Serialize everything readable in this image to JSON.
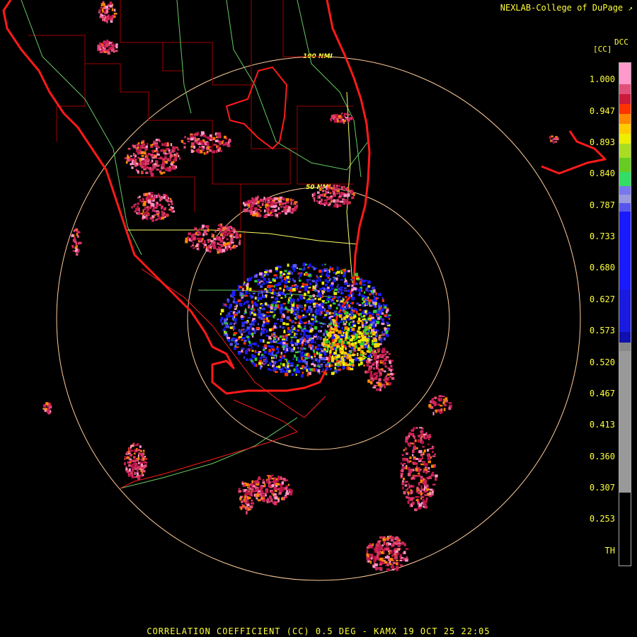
{
  "header": {
    "credit": "NEXLAB-College of DuPage",
    "credit_icon": "external-link-icon"
  },
  "legend": {
    "product": "DCC",
    "unit": "[CC]",
    "ticks": [
      "1.000",
      "0.947",
      "0.893",
      "0.840",
      "0.787",
      "0.733",
      "0.680",
      "0.627",
      "0.573",
      "0.520",
      "0.467",
      "0.413",
      "0.360",
      "0.307",
      "0.253",
      "TH"
    ],
    "colors": {
      "high": "#ff99cc",
      "mid": "#ffcc00",
      "green": "#33cc33",
      "blue": "#1a1aff",
      "gray": "#999999",
      "coast": "#ff1a1a",
      "ring": "#ffcc99"
    }
  },
  "map": {
    "radar_site": "KAMX",
    "ring_labels": [
      "100 NMI",
      "50 NMI"
    ]
  },
  "footer": {
    "caption": "CORRELATION COEFFICIENT (CC) 0.5 DEG - KAMX 19 OCT 25 22:05"
  }
}
